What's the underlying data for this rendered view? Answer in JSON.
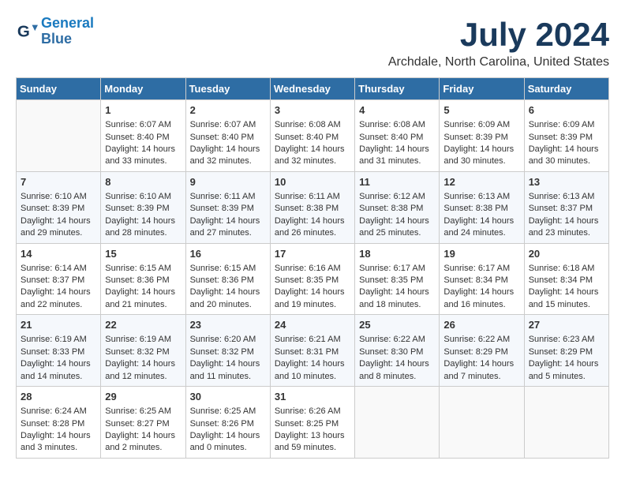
{
  "logo": {
    "line1": "General",
    "line2": "Blue"
  },
  "title": "July 2024",
  "subtitle": "Archdale, North Carolina, United States",
  "weekdays": [
    "Sunday",
    "Monday",
    "Tuesday",
    "Wednesday",
    "Thursday",
    "Friday",
    "Saturday"
  ],
  "weeks": [
    [
      {
        "day": null,
        "content": null
      },
      {
        "day": "1",
        "content": "Sunrise: 6:07 AM\nSunset: 8:40 PM\nDaylight: 14 hours\nand 33 minutes."
      },
      {
        "day": "2",
        "content": "Sunrise: 6:07 AM\nSunset: 8:40 PM\nDaylight: 14 hours\nand 32 minutes."
      },
      {
        "day": "3",
        "content": "Sunrise: 6:08 AM\nSunset: 8:40 PM\nDaylight: 14 hours\nand 32 minutes."
      },
      {
        "day": "4",
        "content": "Sunrise: 6:08 AM\nSunset: 8:40 PM\nDaylight: 14 hours\nand 31 minutes."
      },
      {
        "day": "5",
        "content": "Sunrise: 6:09 AM\nSunset: 8:39 PM\nDaylight: 14 hours\nand 30 minutes."
      },
      {
        "day": "6",
        "content": "Sunrise: 6:09 AM\nSunset: 8:39 PM\nDaylight: 14 hours\nand 30 minutes."
      }
    ],
    [
      {
        "day": "7",
        "content": "Sunrise: 6:10 AM\nSunset: 8:39 PM\nDaylight: 14 hours\nand 29 minutes."
      },
      {
        "day": "8",
        "content": "Sunrise: 6:10 AM\nSunset: 8:39 PM\nDaylight: 14 hours\nand 28 minutes."
      },
      {
        "day": "9",
        "content": "Sunrise: 6:11 AM\nSunset: 8:39 PM\nDaylight: 14 hours\nand 27 minutes."
      },
      {
        "day": "10",
        "content": "Sunrise: 6:11 AM\nSunset: 8:38 PM\nDaylight: 14 hours\nand 26 minutes."
      },
      {
        "day": "11",
        "content": "Sunrise: 6:12 AM\nSunset: 8:38 PM\nDaylight: 14 hours\nand 25 minutes."
      },
      {
        "day": "12",
        "content": "Sunrise: 6:13 AM\nSunset: 8:38 PM\nDaylight: 14 hours\nand 24 minutes."
      },
      {
        "day": "13",
        "content": "Sunrise: 6:13 AM\nSunset: 8:37 PM\nDaylight: 14 hours\nand 23 minutes."
      }
    ],
    [
      {
        "day": "14",
        "content": "Sunrise: 6:14 AM\nSunset: 8:37 PM\nDaylight: 14 hours\nand 22 minutes."
      },
      {
        "day": "15",
        "content": "Sunrise: 6:15 AM\nSunset: 8:36 PM\nDaylight: 14 hours\nand 21 minutes."
      },
      {
        "day": "16",
        "content": "Sunrise: 6:15 AM\nSunset: 8:36 PM\nDaylight: 14 hours\nand 20 minutes."
      },
      {
        "day": "17",
        "content": "Sunrise: 6:16 AM\nSunset: 8:35 PM\nDaylight: 14 hours\nand 19 minutes."
      },
      {
        "day": "18",
        "content": "Sunrise: 6:17 AM\nSunset: 8:35 PM\nDaylight: 14 hours\nand 18 minutes."
      },
      {
        "day": "19",
        "content": "Sunrise: 6:17 AM\nSunset: 8:34 PM\nDaylight: 14 hours\nand 16 minutes."
      },
      {
        "day": "20",
        "content": "Sunrise: 6:18 AM\nSunset: 8:34 PM\nDaylight: 14 hours\nand 15 minutes."
      }
    ],
    [
      {
        "day": "21",
        "content": "Sunrise: 6:19 AM\nSunset: 8:33 PM\nDaylight: 14 hours\nand 14 minutes."
      },
      {
        "day": "22",
        "content": "Sunrise: 6:19 AM\nSunset: 8:32 PM\nDaylight: 14 hours\nand 12 minutes."
      },
      {
        "day": "23",
        "content": "Sunrise: 6:20 AM\nSunset: 8:32 PM\nDaylight: 14 hours\nand 11 minutes."
      },
      {
        "day": "24",
        "content": "Sunrise: 6:21 AM\nSunset: 8:31 PM\nDaylight: 14 hours\nand 10 minutes."
      },
      {
        "day": "25",
        "content": "Sunrise: 6:22 AM\nSunset: 8:30 PM\nDaylight: 14 hours\nand 8 minutes."
      },
      {
        "day": "26",
        "content": "Sunrise: 6:22 AM\nSunset: 8:29 PM\nDaylight: 14 hours\nand 7 minutes."
      },
      {
        "day": "27",
        "content": "Sunrise: 6:23 AM\nSunset: 8:29 PM\nDaylight: 14 hours\nand 5 minutes."
      }
    ],
    [
      {
        "day": "28",
        "content": "Sunrise: 6:24 AM\nSunset: 8:28 PM\nDaylight: 14 hours\nand 3 minutes."
      },
      {
        "day": "29",
        "content": "Sunrise: 6:25 AM\nSunset: 8:27 PM\nDaylight: 14 hours\nand 2 minutes."
      },
      {
        "day": "30",
        "content": "Sunrise: 6:25 AM\nSunset: 8:26 PM\nDaylight: 14 hours\nand 0 minutes."
      },
      {
        "day": "31",
        "content": "Sunrise: 6:26 AM\nSunset: 8:25 PM\nDaylight: 13 hours\nand 59 minutes."
      },
      {
        "day": null,
        "content": null
      },
      {
        "day": null,
        "content": null
      },
      {
        "day": null,
        "content": null
      }
    ]
  ]
}
